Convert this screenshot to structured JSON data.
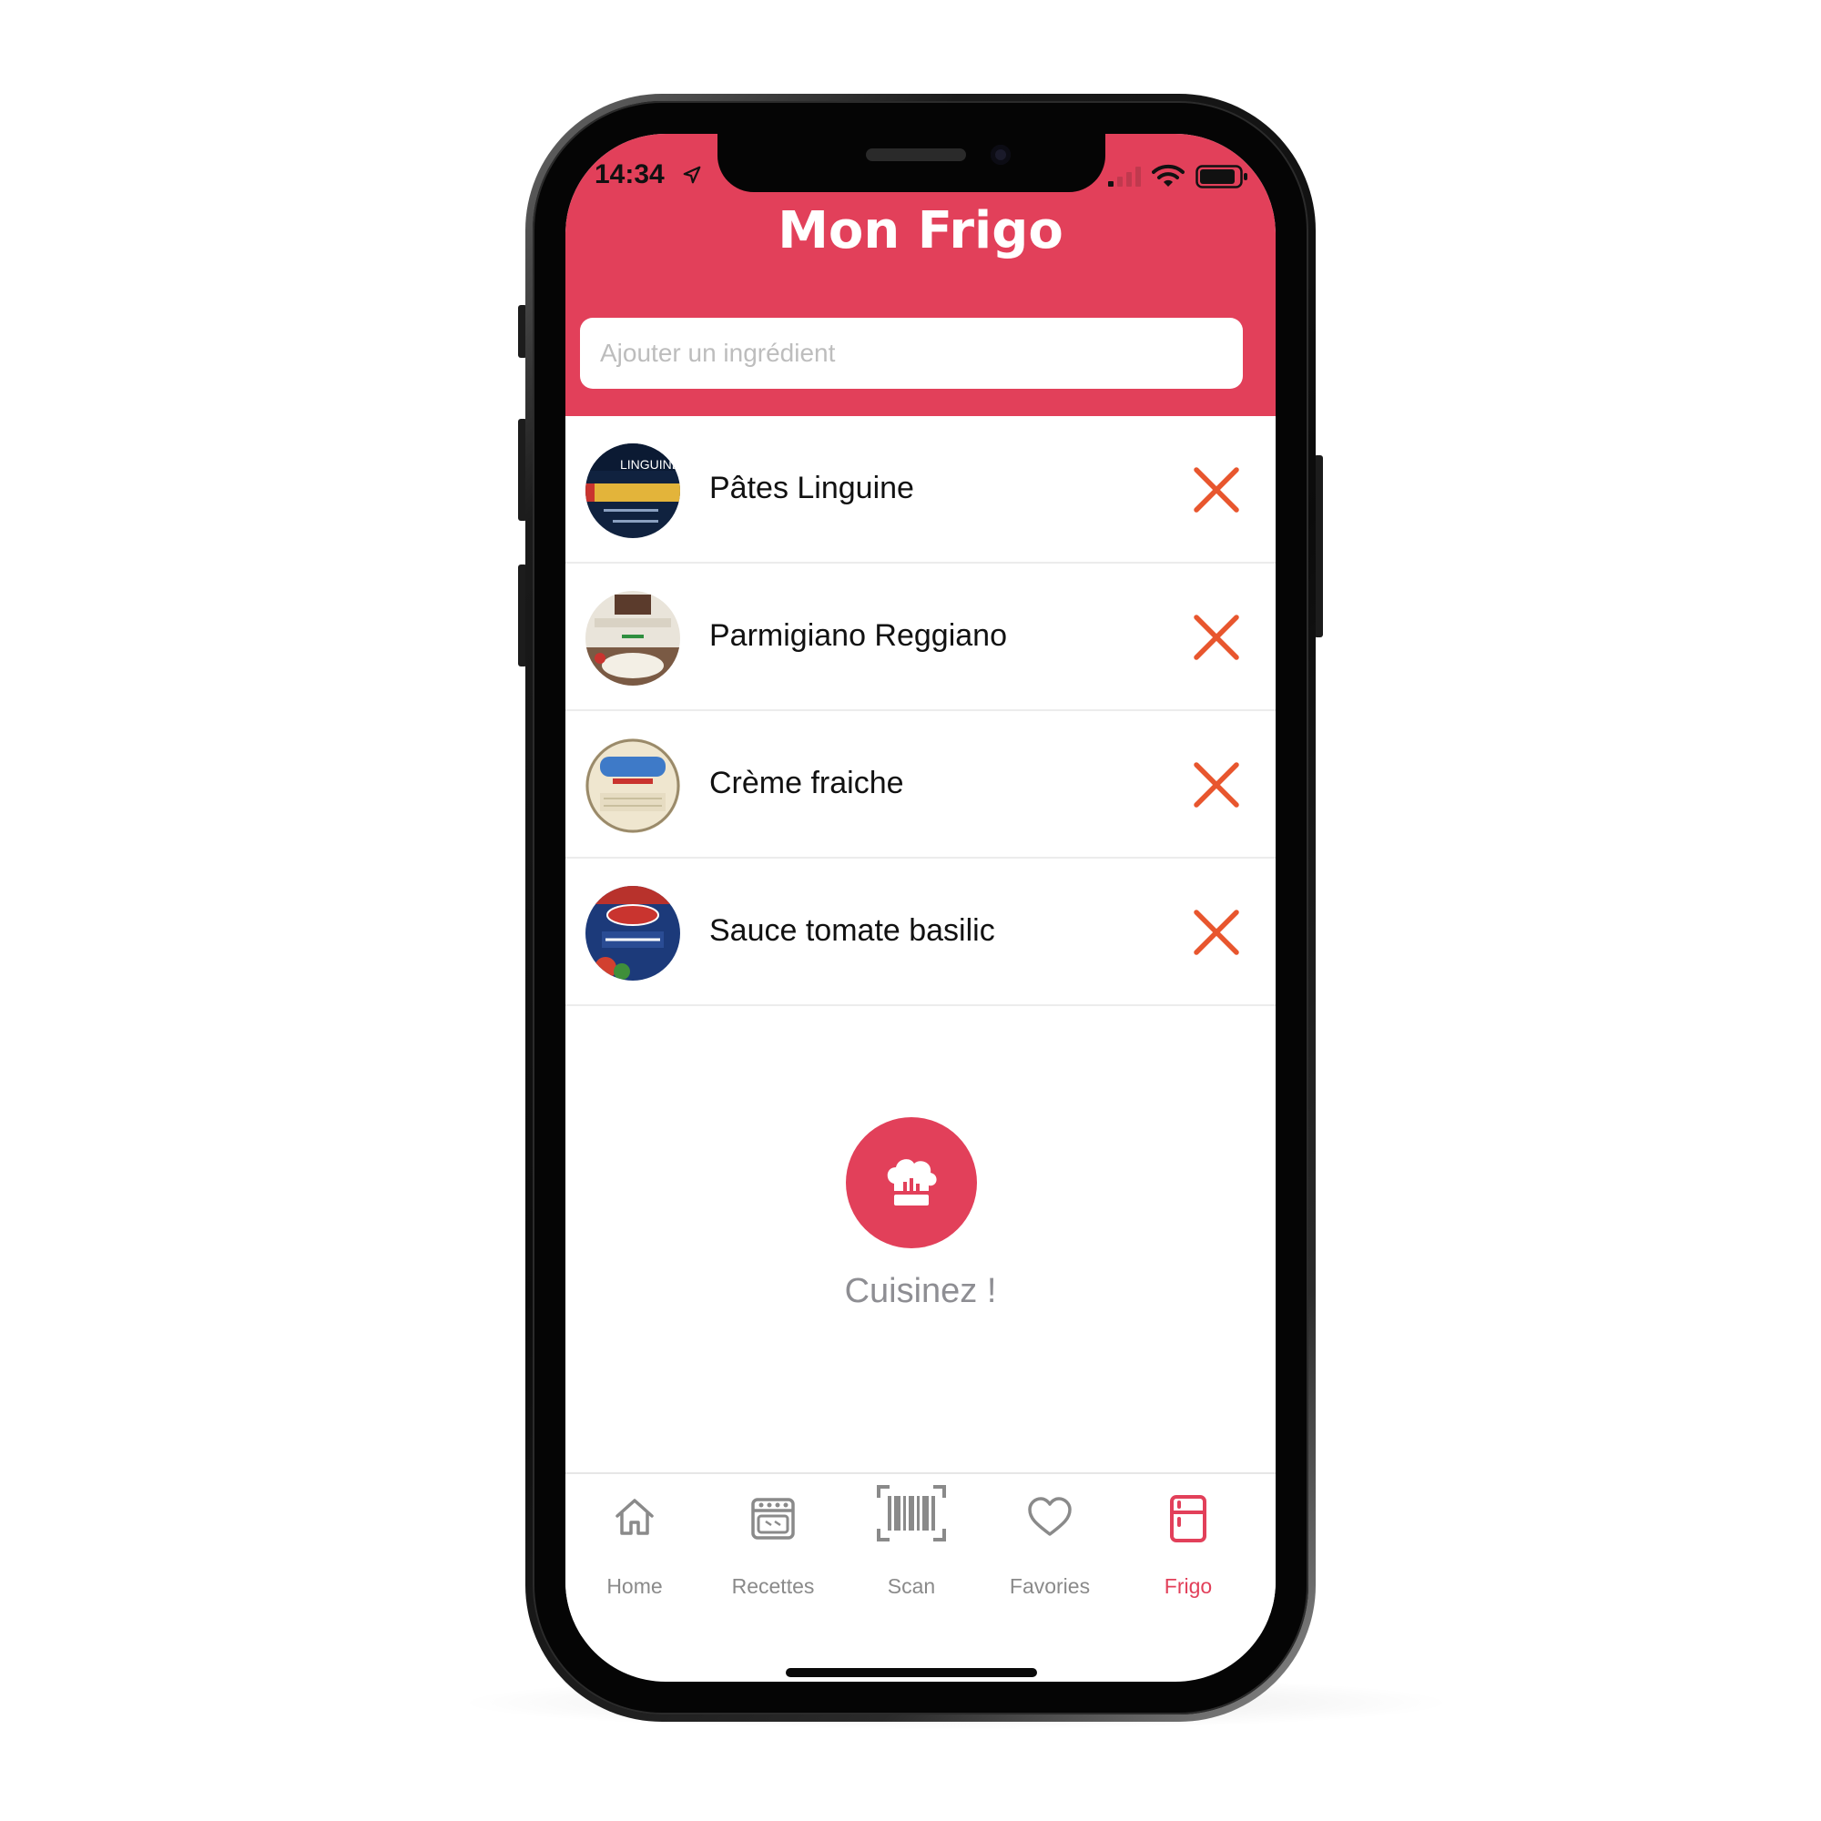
{
  "status_bar": {
    "time": "14:34"
  },
  "header": {
    "title": "Mon Frigo"
  },
  "search": {
    "placeholder": "Ajouter un ingrédient"
  },
  "ingredients": [
    {
      "name": "Pâtes Linguine"
    },
    {
      "name": "Parmigiano Reggiano"
    },
    {
      "name": "Crème fraiche"
    },
    {
      "name": "Sauce tomate basilic"
    }
  ],
  "cook": {
    "label": "Cuisinez !"
  },
  "tabs": [
    {
      "label": "Home",
      "icon": "home-icon",
      "active": false
    },
    {
      "label": "Recettes",
      "icon": "oven-icon",
      "active": false
    },
    {
      "label": "Scan",
      "icon": "barcode-icon",
      "active": false
    },
    {
      "label": "Favories",
      "icon": "heart-icon",
      "active": false
    },
    {
      "label": "Frigo",
      "icon": "fridge-icon",
      "active": true
    }
  ],
  "colors": {
    "accent": "#e2405a",
    "remove": "#e8562e",
    "inactive": "#8a8a8a"
  }
}
